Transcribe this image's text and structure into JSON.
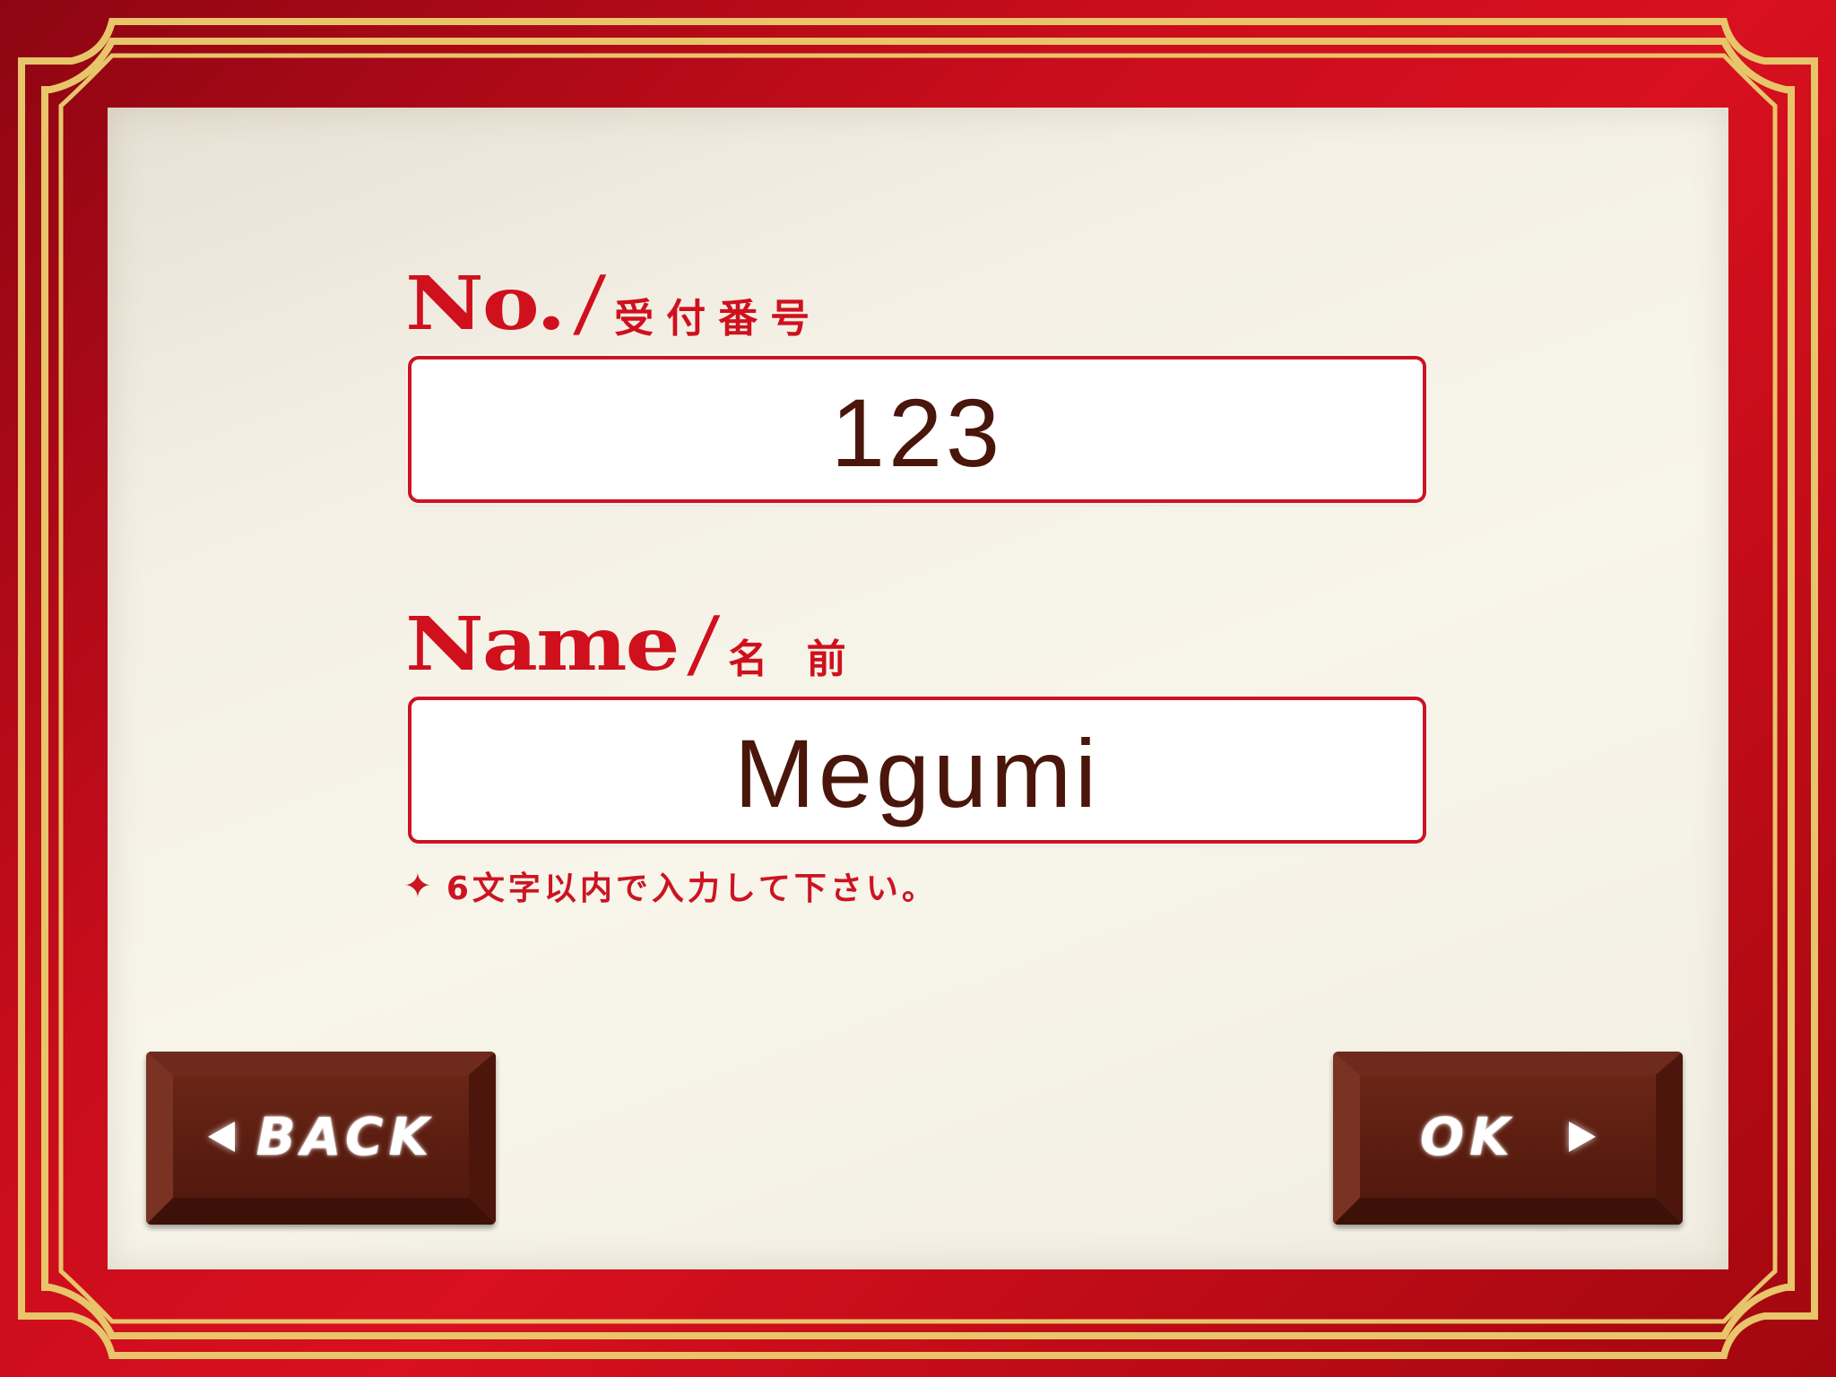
{
  "fields": {
    "number": {
      "label_en": "No.",
      "slash": "/",
      "label_jp": "受付番号",
      "value": "123"
    },
    "name": {
      "label_en": "Name",
      "slash": "/",
      "label_jp": "名 前",
      "value": "Megumi",
      "note": "6文字以内で入力して下さい。",
      "note_marker": "✦"
    }
  },
  "buttons": {
    "back": {
      "label": "BACK",
      "icon": "arrow-left-icon"
    },
    "ok": {
      "label": "OK",
      "icon": "arrow-right-icon"
    }
  },
  "colors": {
    "frame_red": "#c90d1c",
    "frame_gold": "#e8c46a",
    "label_red": "#d0101d",
    "value_brown": "#4a150a",
    "chocolate": "#5c1c10"
  }
}
